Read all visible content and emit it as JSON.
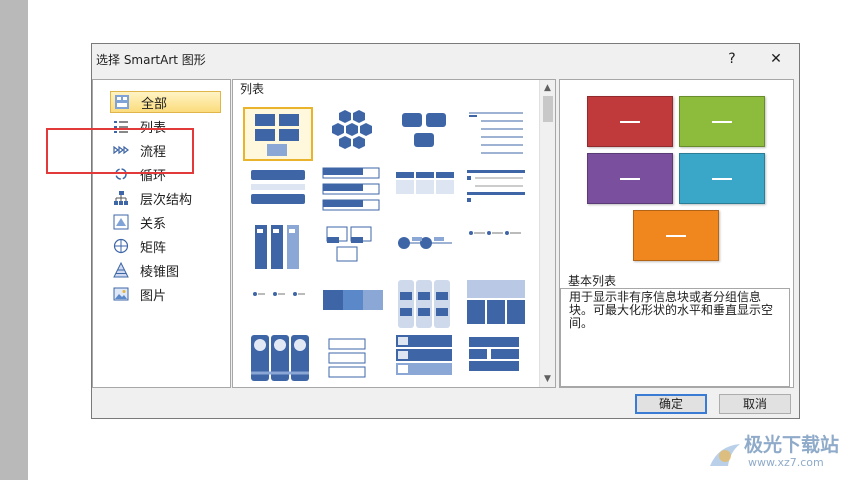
{
  "window": {
    "title": "选择 SmartArt 图形",
    "help_label": "?",
    "close_label": "✕"
  },
  "categories": [
    {
      "label": "全部",
      "icon": "all-icon",
      "selected": true
    },
    {
      "label": "列表",
      "icon": "list-icon",
      "selected": false
    },
    {
      "label": "流程",
      "icon": "process-icon",
      "selected": false
    },
    {
      "label": "循环",
      "icon": "cycle-icon",
      "selected": false
    },
    {
      "label": "层次结构",
      "icon": "hierarchy-icon",
      "selected": false
    },
    {
      "label": "关系",
      "icon": "relationship-icon",
      "selected": false
    },
    {
      "label": "矩阵",
      "icon": "matrix-icon",
      "selected": false
    },
    {
      "label": "棱锥图",
      "icon": "pyramid-icon",
      "selected": false
    },
    {
      "label": "图片",
      "icon": "picture-icon",
      "selected": false
    }
  ],
  "gallery": {
    "heading": "列表",
    "selected_index": 0
  },
  "preview": {
    "name": "基本列表",
    "description": "用于显示非有序信息块或者分组信息块。可最大化形状的水平和垂直显示空间。",
    "colors": [
      "#c0393b",
      "#8dbb3b",
      "#7a4f9e",
      "#3aa7c9",
      "#f0861e"
    ]
  },
  "buttons": {
    "ok": "确定",
    "cancel": "取消"
  },
  "watermark": {
    "text": "极光下载站",
    "url": "www.xz7.com"
  },
  "colors": {
    "accent_blue": "#3e66a7",
    "selection": "#f8d668",
    "highlight_border": "#e23a3a"
  }
}
